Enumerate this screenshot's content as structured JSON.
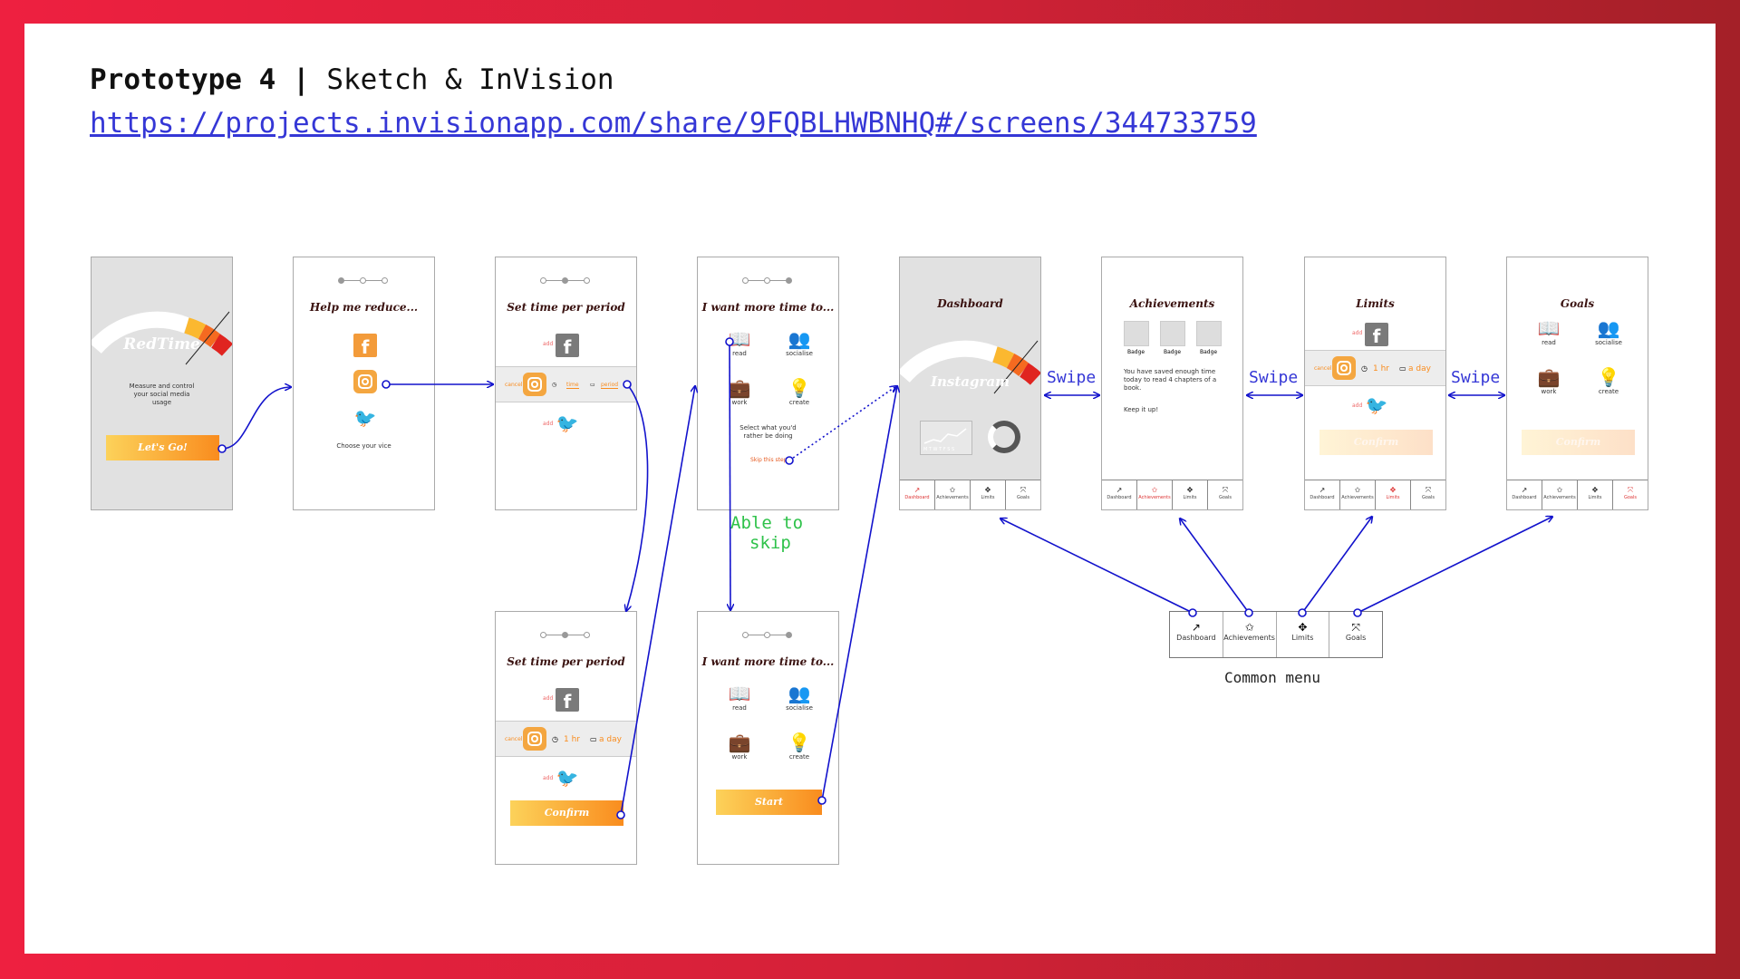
{
  "header": {
    "title_bold": "Prototype 4 |",
    "title_rest": "Sketch & InVision",
    "link": "https://projects.invisionapp.com/share/9FQBLHWBNHQ#/screens/344733759"
  },
  "splash": {
    "app_name": "RedTime",
    "tagline": "Measure and control your social media usage",
    "button": "Let's Go!"
  },
  "reduce": {
    "heading": "Help me reduce...",
    "caption": "Choose your vice"
  },
  "set_time_a": {
    "heading": "Set time per period",
    "add1": "add",
    "cancel": "cancel",
    "time": "time",
    "period": "period",
    "add2": "add"
  },
  "set_time_b": {
    "heading": "Set time per period",
    "add1": "add",
    "cancel": "cancel",
    "time_value": "1 hr",
    "period_value": "a day",
    "add2": "add",
    "button": "Confirm"
  },
  "more_time_a": {
    "heading": "I want more time to...",
    "items": [
      "read",
      "socialise",
      "work",
      "create"
    ],
    "prompt": "Select what you'd rather be doing",
    "skip": "Skip this step"
  },
  "more_time_b": {
    "heading": "I want more time to...",
    "items": [
      "read",
      "socialise",
      "work",
      "create"
    ],
    "button": "Start"
  },
  "dashboard": {
    "heading": "Dashboard",
    "platform": "Instagram",
    "chart_caption": "M T W T F S S"
  },
  "achievements": {
    "heading": "Achievements",
    "badges": [
      "Badge",
      "Badge",
      "Badge"
    ],
    "message": "You have saved enough time today to read 4 chapters of a book.",
    "cheer": "Keep it up!"
  },
  "limits": {
    "heading": "Limits",
    "add1": "add",
    "cancel": "cancel",
    "time_value": "1 hr",
    "period_value": "a day",
    "add2": "add",
    "button": "Confirm"
  },
  "goals": {
    "heading": "Goals",
    "items": [
      "read",
      "socialise",
      "work",
      "create"
    ],
    "button": "Confirm"
  },
  "nav": [
    "Dashboard",
    "Achievements",
    "Limits",
    "Goals"
  ],
  "annotations": {
    "swipe": "Swipe",
    "able_to_skip_1": "Able to",
    "able_to_skip_2": "skip",
    "common_menu": "Common menu"
  },
  "common_menu": [
    {
      "icon": "trend-icon",
      "glyph": "↗",
      "label": "Dashboard"
    },
    {
      "icon": "star-icon",
      "glyph": "✩",
      "label": "Achievements"
    },
    {
      "icon": "move-icon",
      "glyph": "✥",
      "label": "Limits"
    },
    {
      "icon": "target-icon",
      "glyph": "⤧",
      "label": "Goals"
    }
  ],
  "colors": {
    "accent": "#f98c1e",
    "flow": "#1212cc",
    "annotation": "#3537d6",
    "skip_note": "#2ec24a",
    "frame": "#d42138"
  }
}
